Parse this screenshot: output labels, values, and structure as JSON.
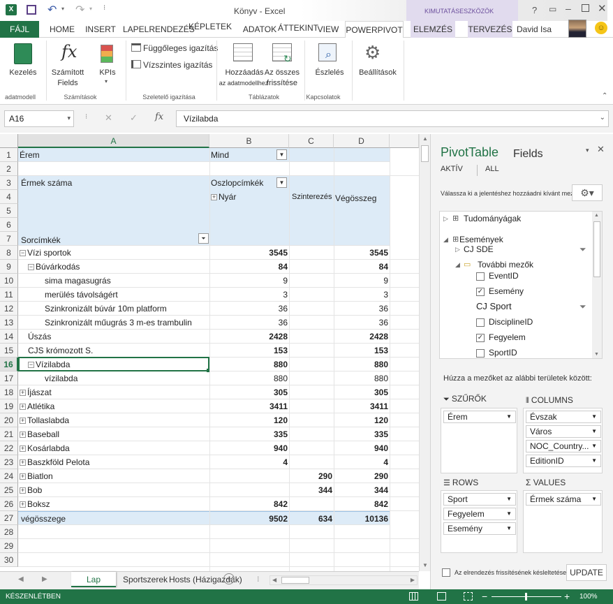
{
  "titlebar": {
    "title": "Könyv - Excel",
    "context": "KIMUTATÁSESZKÖZÖK",
    "user": "David Isa"
  },
  "tabs": [
    "FÁJL",
    "HOME",
    "INSERT",
    "LAPELRENDEZÉS",
    "KÉPLETEK",
    "ADATOK",
    "ÁTTEKINT",
    "VIEW",
    "POWERPIVOT",
    "ELEMZÉS",
    "TERVEZÉS"
  ],
  "ribbon": {
    "kezeles": "Kezelés",
    "szamitott1": "Számított",
    "szamitott2": "Fields",
    "kpis": "KPIs",
    "fugg": "Függőleges igazítás",
    "vizsz": "Vízszintes igazítás",
    "hozzaadas1": "Hozzáadás",
    "hozzaadas2": "az adatmodellhez",
    "frissites1": "Az összes",
    "frissites2": "frissítése",
    "eszleles": "Észlelés",
    "beallitasok": "Beállítások",
    "g1": "adatmodell",
    "g2": "Számítások",
    "g3": "Szeletelő igazítása",
    "g4": "Táblázatok",
    "g5": "Kapcsolatok"
  },
  "formula": {
    "namebox": "A16",
    "value": "Vízilabda"
  },
  "grid": {
    "cols": [
      "A",
      "B",
      "C",
      "D"
    ],
    "rownums": [
      "1",
      "2",
      "3",
      "4",
      "5",
      "6",
      "7",
      "8",
      "9",
      "10",
      "11",
      "12",
      "13",
      "14",
      "15",
      "16",
      "17",
      "18",
      "19",
      "20",
      "21",
      "22",
      "23",
      "24",
      "25",
      "26",
      "27",
      "28",
      "29",
      "30"
    ],
    "r1a": "Érem",
    "r1b": "Mind",
    "r3a": "Érmek száma",
    "r3b": "Oszlopcímkék",
    "r4b": "Nyár",
    "r4c": "Szinterezés",
    "r4d": "Végösszeg",
    "r7a": "Sorcímkék",
    "rows": [
      {
        "label": "Vízi sportok",
        "b": "3545",
        "c": "",
        "d": "3545",
        "bold": true,
        "pm": "−",
        "ind": 0
      },
      {
        "label": "Búvárkodás",
        "b": "84",
        "c": "",
        "d": "84",
        "bold": true,
        "pm": "−",
        "ind": 1
      },
      {
        "label": "sima magasugrás",
        "b": "9",
        "c": "",
        "d": "9",
        "bold": false,
        "pm": "",
        "ind": 3
      },
      {
        "label": "merülés távolságért",
        "b": "3",
        "c": "",
        "d": "3",
        "bold": false,
        "pm": "",
        "ind": 3
      },
      {
        "label": "Szinkronizált búvár 10m platform",
        "b": "36",
        "c": "",
        "d": "36",
        "bold": false,
        "pm": "",
        "ind": 3
      },
      {
        "label": "Szinkronizált műugrás 3 m-es trambulin",
        "b": "36",
        "c": "",
        "d": "36",
        "bold": false,
        "pm": "",
        "ind": 3
      },
      {
        "label": "Úszás",
        "b": "2428",
        "c": "",
        "d": "2428",
        "bold": true,
        "pm": "",
        "ind": 1
      },
      {
        "label": "CJS krómozott S.",
        "b": "153",
        "c": "",
        "d": "153",
        "bold": true,
        "pm": "",
        "ind": 1
      },
      {
        "label": "Vízilabda",
        "b": "880",
        "c": "",
        "d": "880",
        "bold": true,
        "pm": "−",
        "ind": 1
      },
      {
        "label": "vízilabda",
        "b": "880",
        "c": "",
        "d": "880",
        "bold": false,
        "pm": "",
        "ind": 3
      },
      {
        "label": "Íjászat",
        "b": "305",
        "c": "",
        "d": "305",
        "bold": true,
        "pm": "+",
        "ind": 0
      },
      {
        "label": "Atlétika",
        "b": "3411",
        "c": "",
        "d": "3411",
        "bold": true,
        "pm": "+",
        "ind": 0
      },
      {
        "label": "Tollaslabda",
        "b": "120",
        "c": "",
        "d": "120",
        "bold": true,
        "pm": "+",
        "ind": 0
      },
      {
        "label": "Baseball",
        "b": "335",
        "c": "",
        "d": "335",
        "bold": true,
        "pm": "+",
        "ind": 0
      },
      {
        "label": "Kosárlabda",
        "b": "940",
        "c": "",
        "d": "940",
        "bold": true,
        "pm": "+",
        "ind": 0
      },
      {
        "label": "Baszkföld Pelota",
        "b": "4",
        "c": "",
        "d": "4",
        "bold": true,
        "pm": "+",
        "ind": 0
      },
      {
        "label": "Biatlon",
        "b": "",
        "c": "290",
        "d": "290",
        "bold": true,
        "pm": "+",
        "ind": 0
      },
      {
        "label": "Bob",
        "b": "",
        "c": "344",
        "d": "344",
        "bold": true,
        "pm": "+",
        "ind": 0
      },
      {
        "label": "Boksz",
        "b": "842",
        "c": "",
        "d": "842",
        "bold": true,
        "pm": "+",
        "ind": 0
      }
    ],
    "total": {
      "label": "végösszege",
      "b": "9502",
      "c": "634",
      "d": "10136"
    }
  },
  "sheets": [
    "Lap",
    "Sportszerek",
    "Hosts (Házigazdák)"
  ],
  "status": {
    "ready": "KÉSZENLÉTBEN",
    "zoom": "100%"
  },
  "pane": {
    "title1": "PivotTable",
    "title2": "Fields",
    "tab_active": "AKTÍV",
    "tab_all": "ALL",
    "instruction": "Válassza ki a jelentéshez hozzáadni kívánt mezőket:",
    "tree": {
      "t1": "Tudományágak",
      "t2": "Események",
      "t3": "CJ SDE",
      "t4": "További mezők",
      "f1": "EventID",
      "f2": "Esemény",
      "t5": "CJ Sport",
      "f3": "DisciplineID",
      "f4": "Fegyelem",
      "f5": "SportID"
    },
    "drag": "Húzza a mezőket az alábbi területek között:",
    "filters_h": "SZŰRŐK",
    "columns_h": "COLUMNS",
    "rows_h": "ROWS",
    "values_h": "VALUES",
    "filters": [
      "Érem"
    ],
    "columns": [
      "Évszak",
      "Város",
      "NOC_Country...",
      "EditionID"
    ],
    "rows": [
      "Sport",
      "Fegyelem",
      "Esemény"
    ],
    "values": [
      "Érmek száma"
    ],
    "defer": "Az elrendezés frissítésének késleltetése",
    "update": "UPDATE"
  }
}
